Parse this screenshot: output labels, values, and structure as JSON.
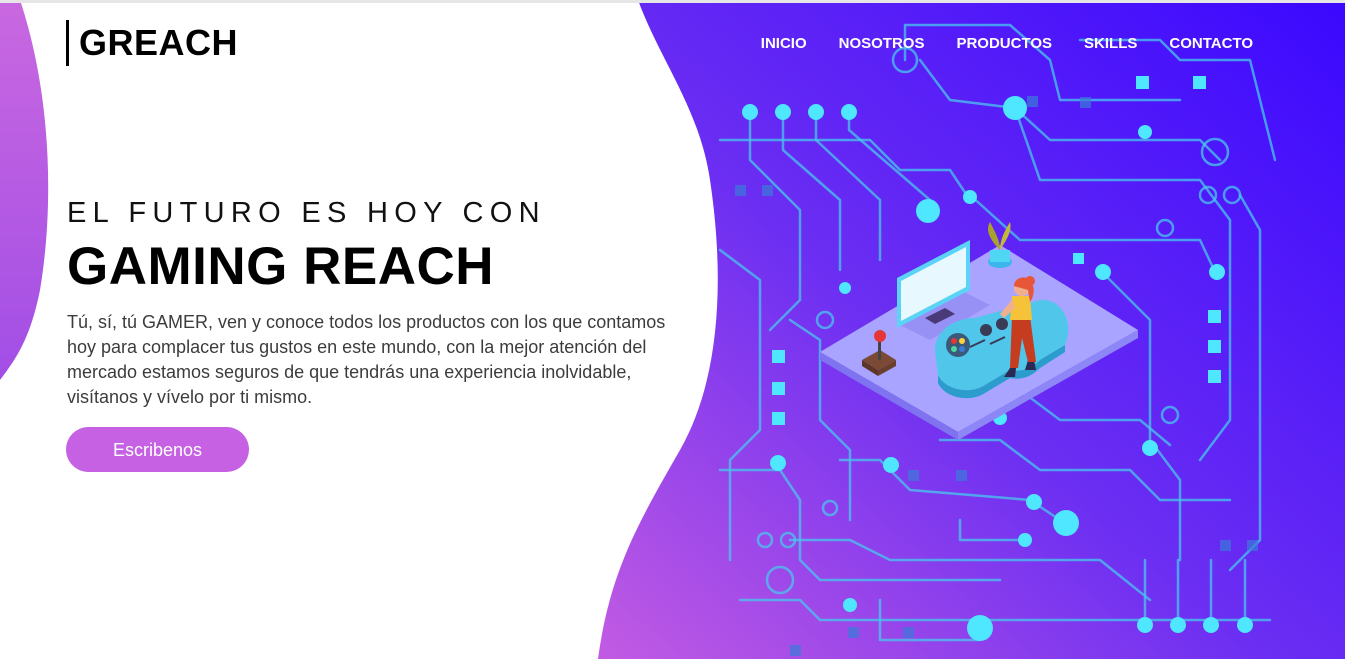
{
  "brand": {
    "logo_text": "GREACH"
  },
  "nav": {
    "items": [
      {
        "label": "INICIO"
      },
      {
        "label": "NOSOTROS"
      },
      {
        "label": "PRODUCTOS"
      },
      {
        "label": "SKILLS"
      },
      {
        "label": "CONTACTO"
      }
    ]
  },
  "hero": {
    "kicker": "EL FUTURO ES HOY CON",
    "title": "GAMING REACH",
    "description": "Tú, sí, tú GAMER, ven y conoce todos los productos con los que contamos hoy para complacer tus gustos en este mundo, con la mejor atención del mercado estamos seguros de que tendrás una experiencia inolvidable, visítanos y vívelo por ti mismo.",
    "cta_label": "Escribenos"
  },
  "colors": {
    "gradient_top": "#3a0bff",
    "gradient_bottom": "#c35be3",
    "circuit": "#4fd6f2",
    "button": "#c561e2"
  },
  "illustration": {
    "icons": [
      "circuit-board-icon",
      "gaming-desk-icon",
      "gamer-girl-icon",
      "monitor-icon",
      "gamepad-icon",
      "joystick-icon",
      "plant-icon"
    ]
  }
}
